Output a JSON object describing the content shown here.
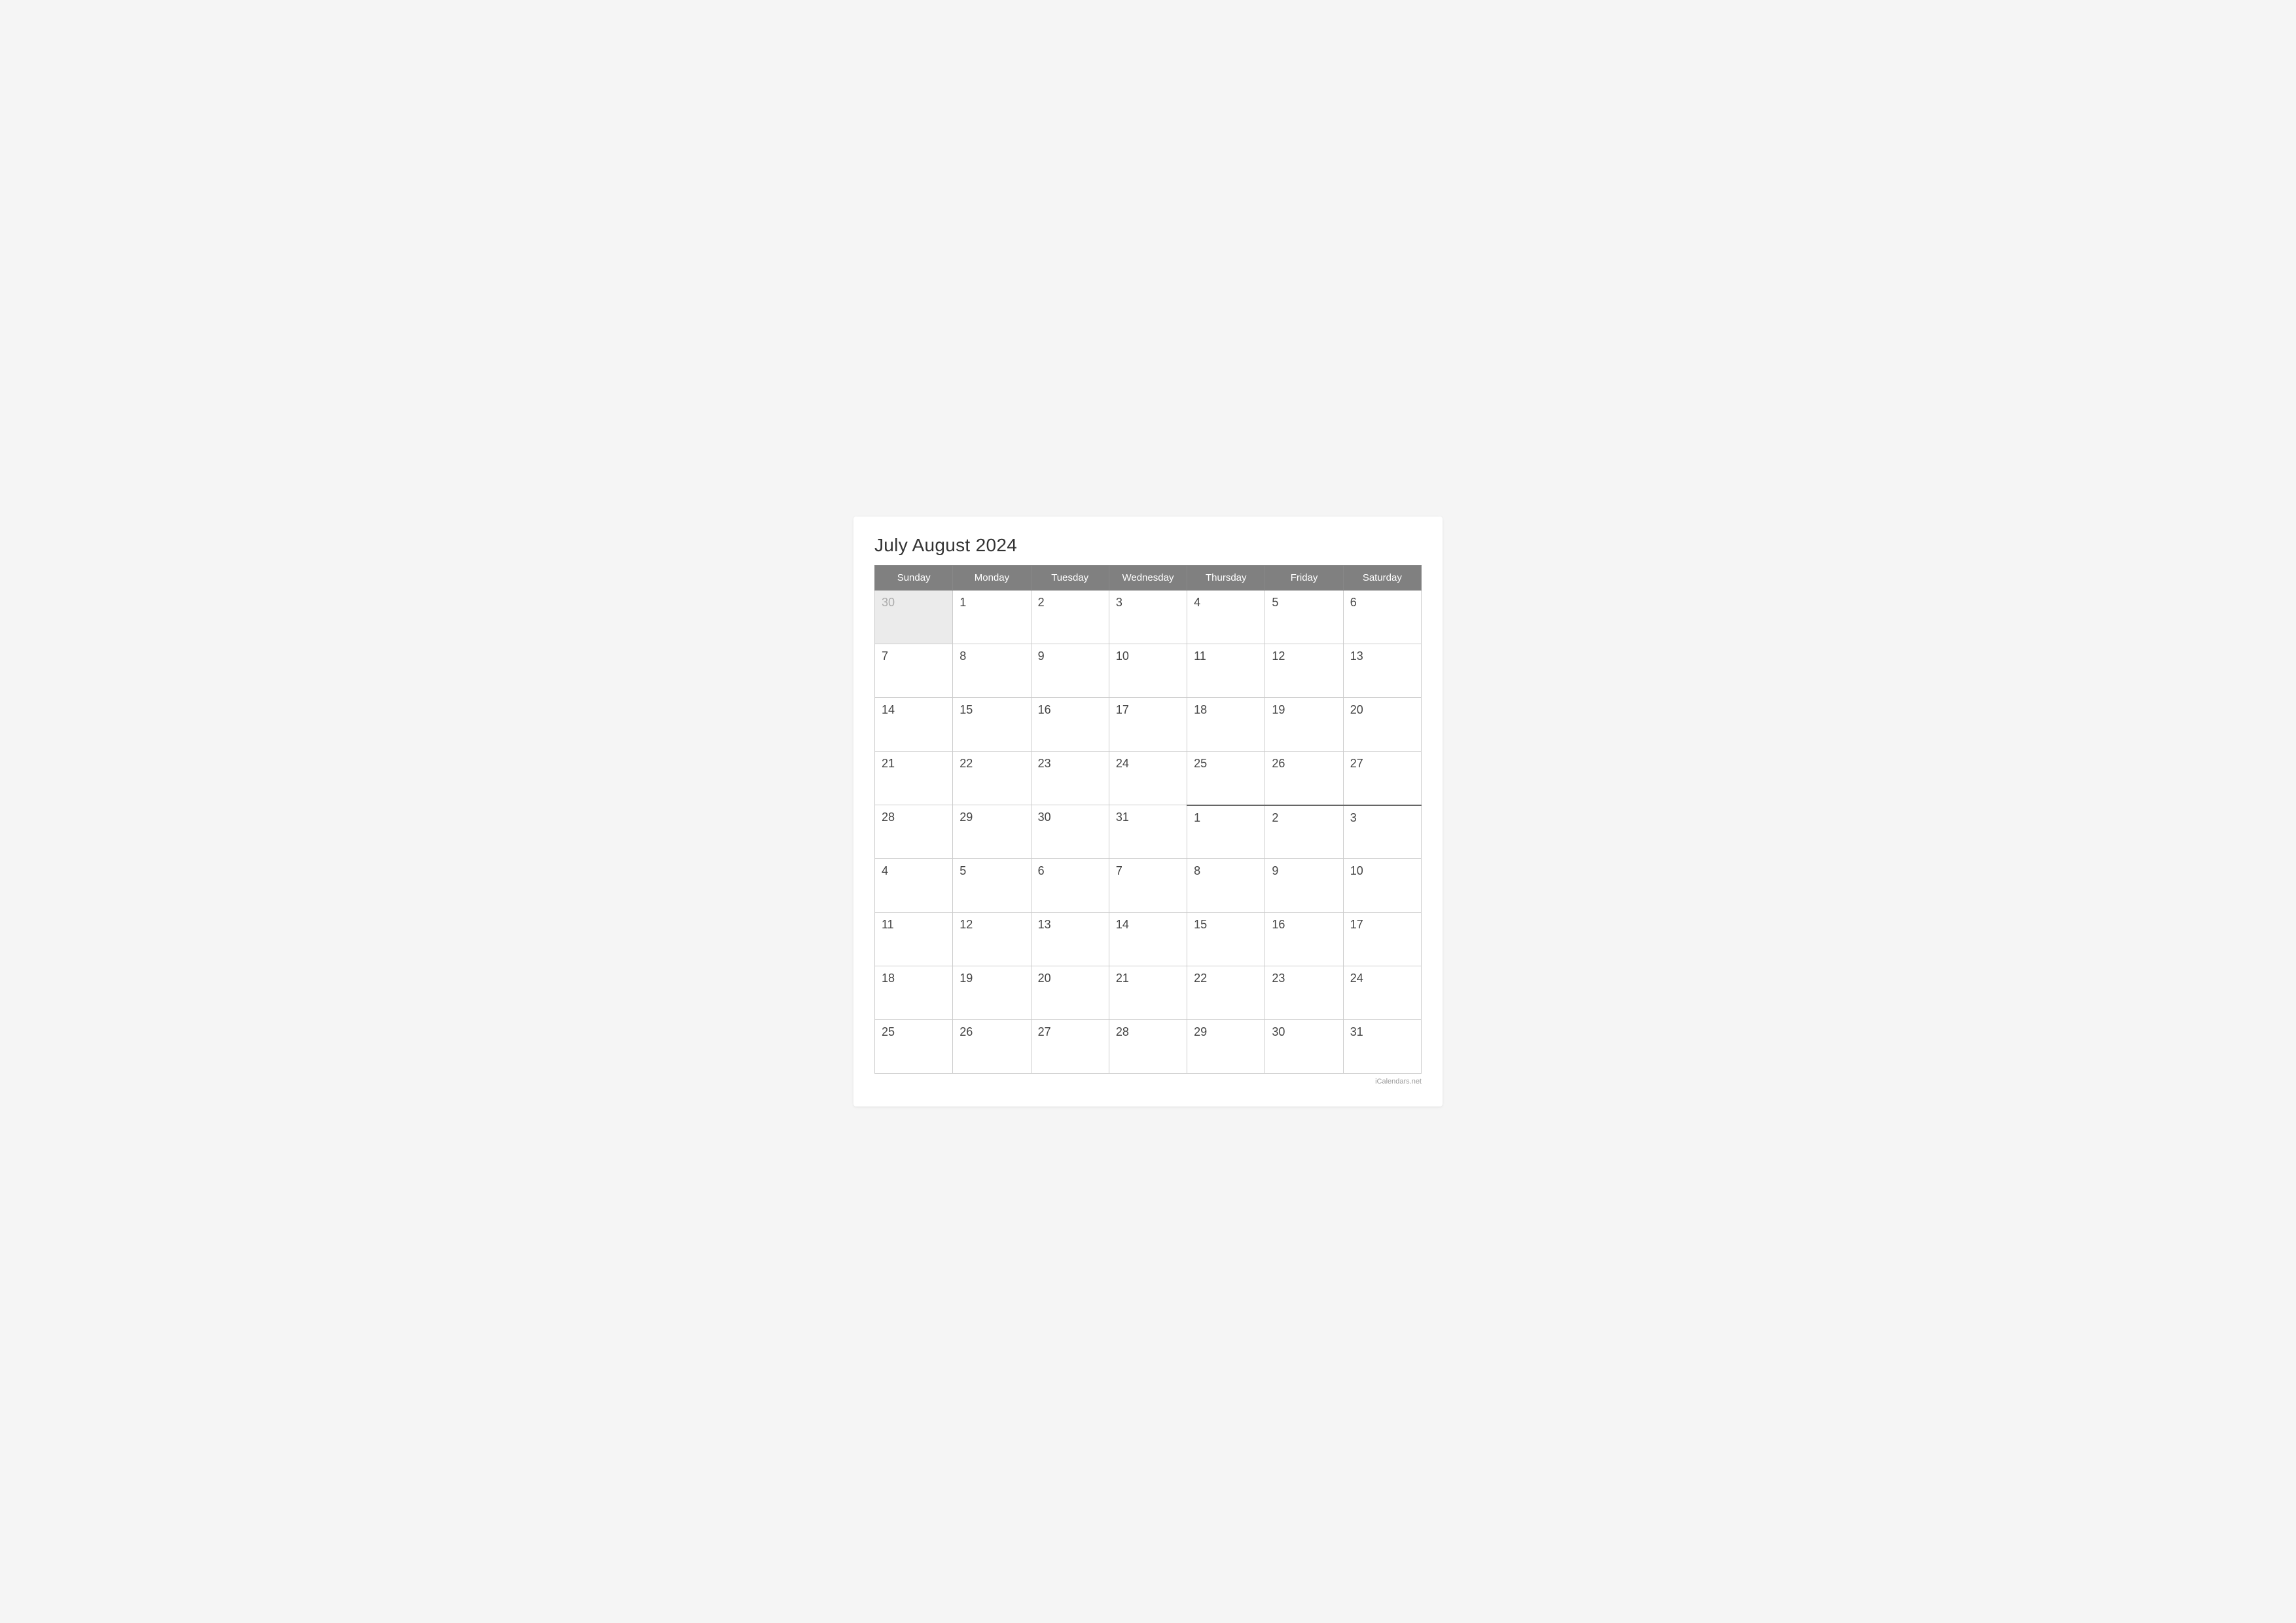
{
  "title": "July August 2024",
  "watermark": "iCalendars.net",
  "headers": [
    "Sunday",
    "Monday",
    "Tuesday",
    "Wednesday",
    "Thursday",
    "Friday",
    "Saturday"
  ],
  "weeks": [
    [
      {
        "day": "30",
        "type": "other-month"
      },
      {
        "day": "1",
        "type": "current"
      },
      {
        "day": "2",
        "type": "current"
      },
      {
        "day": "3",
        "type": "current"
      },
      {
        "day": "4",
        "type": "current"
      },
      {
        "day": "5",
        "type": "current"
      },
      {
        "day": "6",
        "type": "current"
      }
    ],
    [
      {
        "day": "7",
        "type": "current"
      },
      {
        "day": "8",
        "type": "current"
      },
      {
        "day": "9",
        "type": "current"
      },
      {
        "day": "10",
        "type": "current"
      },
      {
        "day": "11",
        "type": "current"
      },
      {
        "day": "12",
        "type": "current"
      },
      {
        "day": "13",
        "type": "current"
      }
    ],
    [
      {
        "day": "14",
        "type": "current"
      },
      {
        "day": "15",
        "type": "current"
      },
      {
        "day": "16",
        "type": "current"
      },
      {
        "day": "17",
        "type": "current"
      },
      {
        "day": "18",
        "type": "current"
      },
      {
        "day": "19",
        "type": "current"
      },
      {
        "day": "20",
        "type": "current"
      }
    ],
    [
      {
        "day": "21",
        "type": "current"
      },
      {
        "day": "22",
        "type": "current"
      },
      {
        "day": "23",
        "type": "current"
      },
      {
        "day": "24",
        "type": "current"
      },
      {
        "day": "25",
        "type": "current"
      },
      {
        "day": "26",
        "type": "current"
      },
      {
        "day": "27",
        "type": "current"
      }
    ],
    [
      {
        "day": "28",
        "type": "current"
      },
      {
        "day": "29",
        "type": "current"
      },
      {
        "day": "30",
        "type": "current"
      },
      {
        "day": "31",
        "type": "current"
      },
      {
        "day": "1",
        "type": "month-boundary"
      },
      {
        "day": "2",
        "type": "month-boundary"
      },
      {
        "day": "3",
        "type": "month-boundary"
      }
    ],
    [
      {
        "day": "4",
        "type": "current"
      },
      {
        "day": "5",
        "type": "current"
      },
      {
        "day": "6",
        "type": "current"
      },
      {
        "day": "7",
        "type": "current"
      },
      {
        "day": "8",
        "type": "current"
      },
      {
        "day": "9",
        "type": "current"
      },
      {
        "day": "10",
        "type": "current"
      }
    ],
    [
      {
        "day": "11",
        "type": "current"
      },
      {
        "day": "12",
        "type": "current"
      },
      {
        "day": "13",
        "type": "current"
      },
      {
        "day": "14",
        "type": "current"
      },
      {
        "day": "15",
        "type": "current"
      },
      {
        "day": "16",
        "type": "current"
      },
      {
        "day": "17",
        "type": "current"
      }
    ],
    [
      {
        "day": "18",
        "type": "current"
      },
      {
        "day": "19",
        "type": "current"
      },
      {
        "day": "20",
        "type": "current"
      },
      {
        "day": "21",
        "type": "current"
      },
      {
        "day": "22",
        "type": "current"
      },
      {
        "day": "23",
        "type": "current"
      },
      {
        "day": "24",
        "type": "current"
      }
    ],
    [
      {
        "day": "25",
        "type": "current"
      },
      {
        "day": "26",
        "type": "current"
      },
      {
        "day": "27",
        "type": "current"
      },
      {
        "day": "28",
        "type": "current"
      },
      {
        "day": "29",
        "type": "current"
      },
      {
        "day": "30",
        "type": "current"
      },
      {
        "day": "31",
        "type": "current"
      }
    ]
  ]
}
